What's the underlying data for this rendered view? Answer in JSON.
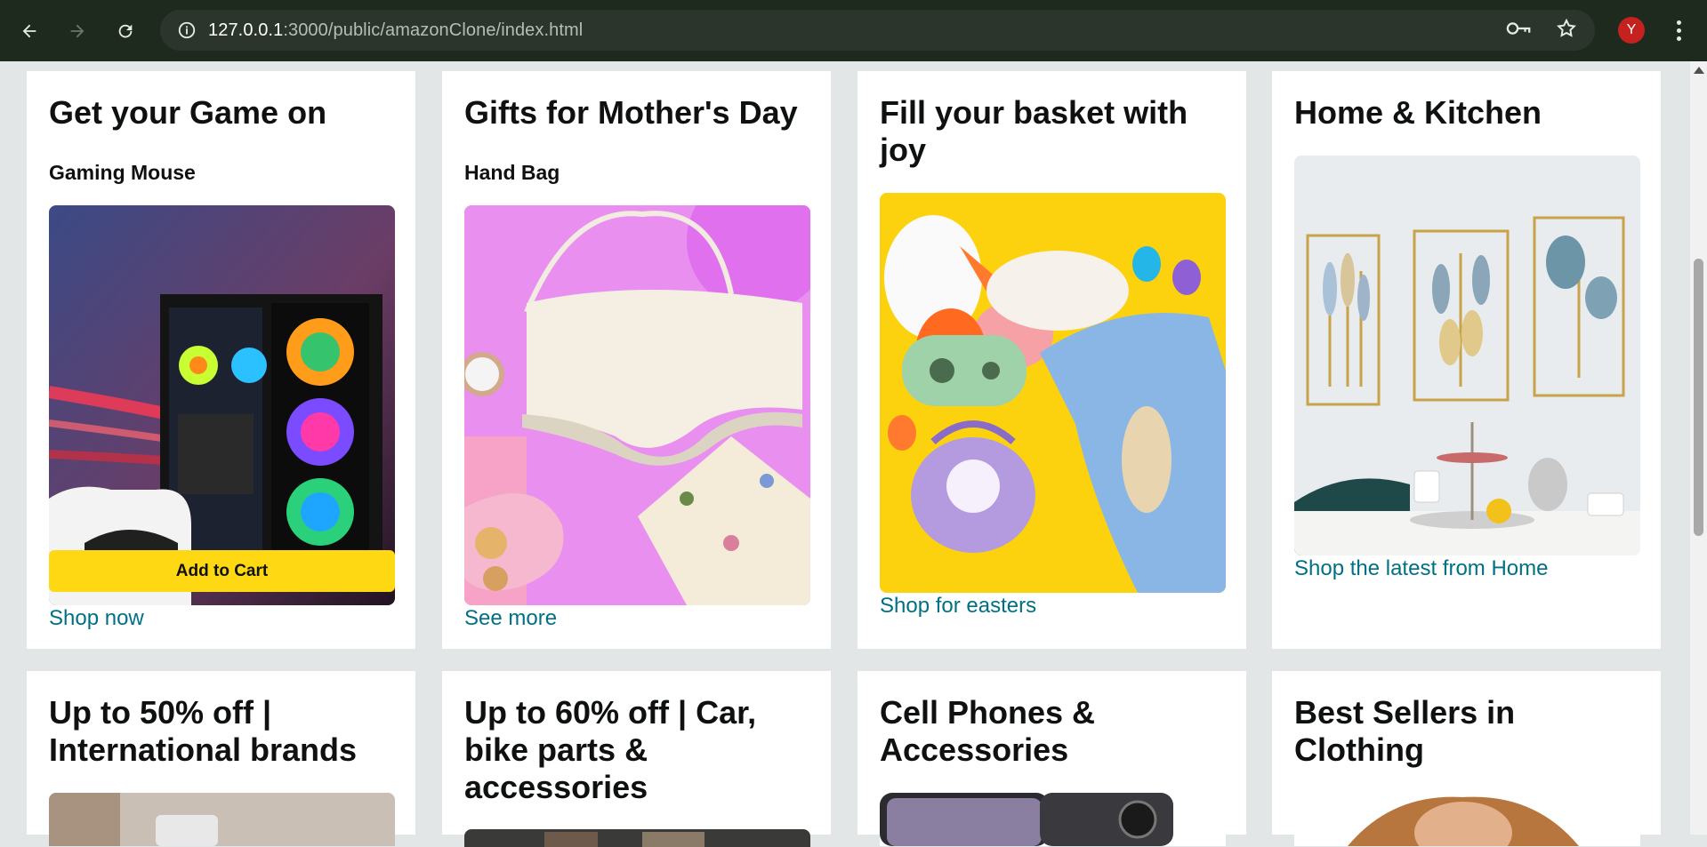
{
  "browser": {
    "url_host": "127.0.0.1",
    "url_path": ":3000/public/amazonClone/index.html",
    "profile_initial": "Y"
  },
  "cards": [
    {
      "title": "Get your Game on",
      "subtitle": "Gaming Mouse",
      "button": "Add to Cart",
      "link": "Shop now"
    },
    {
      "title": "Gifts for Mother's Day",
      "subtitle": "Hand Bag",
      "link": "See more"
    },
    {
      "title": "Fill your basket with joy",
      "link": "Shop for easters"
    },
    {
      "title": "Home & Kitchen",
      "link": "Shop the latest from Home"
    },
    {
      "title": "Up to 50% off | International brands"
    },
    {
      "title": "Up to 60% off | Car, bike parts & accessories"
    },
    {
      "title": "Cell Phones & Accessories"
    },
    {
      "title": "Best Sellers in Clothing"
    }
  ],
  "colors": {
    "accent_button": "#ffd814",
    "link": "#007185",
    "page_bg": "#e3e6e6"
  }
}
